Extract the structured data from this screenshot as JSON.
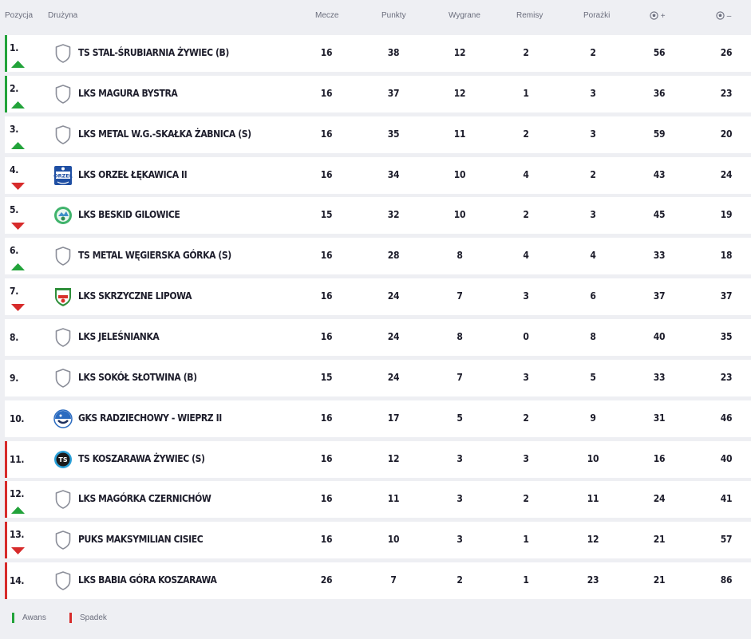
{
  "header": {
    "position": "Pozycja",
    "team": "Drużyna",
    "played": "Mecze",
    "points": "Punkty",
    "won": "Wygrane",
    "drawn": "Remisy",
    "lost": "Porażki",
    "goals_for_sign": "+",
    "goals_against_sign": "–"
  },
  "colors": {
    "promotion": "#22a33a",
    "relegation": "#d72b2b",
    "up_arrow": "#22a33a",
    "down_arrow": "#d72b2b"
  },
  "rows": [
    {
      "pos": "1.",
      "trend": "up",
      "zone": "promo",
      "logo": "shield-placeholder-icon",
      "team": "TS STAL-ŚRUBIARNIA ŻYWIEC (B)",
      "played": "16",
      "points": "38",
      "won": "12",
      "drawn": "2",
      "lost": "2",
      "gf": "56",
      "ga": "26"
    },
    {
      "pos": "2.",
      "trend": "up",
      "zone": "promo",
      "logo": "shield-placeholder-icon",
      "team": "LKS MAGURA BYSTRA",
      "played": "16",
      "points": "37",
      "won": "12",
      "drawn": "1",
      "lost": "3",
      "gf": "36",
      "ga": "23"
    },
    {
      "pos": "3.",
      "trend": "up",
      "zone": "none",
      "logo": "shield-placeholder-icon",
      "team": "LKS METAL W.G.-SKAŁKA ŻABNICA (S)",
      "played": "16",
      "points": "35",
      "won": "11",
      "drawn": "2",
      "lost": "3",
      "gf": "59",
      "ga": "20"
    },
    {
      "pos": "4.",
      "trend": "down",
      "zone": "none",
      "logo": "orzel-crest-icon",
      "team": "LKS ORZEŁ ŁĘKAWICA II",
      "played": "16",
      "points": "34",
      "won": "10",
      "drawn": "4",
      "lost": "2",
      "gf": "43",
      "ga": "24"
    },
    {
      "pos": "5.",
      "trend": "down",
      "zone": "none",
      "logo": "beskid-crest-icon",
      "team": "LKS BESKID GILOWICE",
      "played": "15",
      "points": "32",
      "won": "10",
      "drawn": "2",
      "lost": "3",
      "gf": "45",
      "ga": "19"
    },
    {
      "pos": "6.",
      "trend": "up",
      "zone": "none",
      "logo": "shield-placeholder-icon",
      "team": "TS METAL WĘGIERSKA GÓRKA (S)",
      "played": "16",
      "points": "28",
      "won": "8",
      "drawn": "4",
      "lost": "4",
      "gf": "33",
      "ga": "18"
    },
    {
      "pos": "7.",
      "trend": "down",
      "zone": "none",
      "logo": "skrzyczne-crest-icon",
      "team": "LKS SKRZYCZNE LIPOWA",
      "played": "16",
      "points": "24",
      "won": "7",
      "drawn": "3",
      "lost": "6",
      "gf": "37",
      "ga": "37"
    },
    {
      "pos": "8.",
      "trend": "none",
      "zone": "none",
      "logo": "shield-placeholder-icon",
      "team": "LKS JELEŚNIANKA",
      "played": "16",
      "points": "24",
      "won": "8",
      "drawn": "0",
      "lost": "8",
      "gf": "40",
      "ga": "35"
    },
    {
      "pos": "9.",
      "trend": "none",
      "zone": "none",
      "logo": "shield-placeholder-icon",
      "team": "LKS SOKÓŁ SŁOTWINA (B)",
      "played": "15",
      "points": "24",
      "won": "7",
      "drawn": "3",
      "lost": "5",
      "gf": "33",
      "ga": "23"
    },
    {
      "pos": "10.",
      "trend": "none",
      "zone": "none",
      "logo": "wieprz-crest-icon",
      "team": "GKS RADZIECHOWY - WIEPRZ II",
      "played": "16",
      "points": "17",
      "won": "5",
      "drawn": "2",
      "lost": "9",
      "gf": "31",
      "ga": "46"
    },
    {
      "pos": "11.",
      "trend": "none",
      "zone": "releg",
      "logo": "koszarawa-crest-icon",
      "team": "TS KOSZARAWA ŻYWIEC (S)",
      "played": "16",
      "points": "12",
      "won": "3",
      "drawn": "3",
      "lost": "10",
      "gf": "16",
      "ga": "40"
    },
    {
      "pos": "12.",
      "trend": "up",
      "zone": "releg",
      "logo": "shield-placeholder-icon",
      "team": "LKS MAGÓRKA CZERNICHÓW",
      "played": "16",
      "points": "11",
      "won": "3",
      "drawn": "2",
      "lost": "11",
      "gf": "24",
      "ga": "41"
    },
    {
      "pos": "13.",
      "trend": "down",
      "zone": "releg",
      "logo": "shield-placeholder-icon",
      "team": "PUKS MAKSYMILIAN CISIEC",
      "played": "16",
      "points": "10",
      "won": "3",
      "drawn": "1",
      "lost": "12",
      "gf": "21",
      "ga": "57"
    },
    {
      "pos": "14.",
      "trend": "none",
      "zone": "releg",
      "logo": "shield-placeholder-icon",
      "team": "LKS BABIA GÓRA KOSZARAWA",
      "played": "26",
      "points": "7",
      "won": "2",
      "drawn": "1",
      "lost": "23",
      "gf": "21",
      "ga": "86"
    }
  ],
  "legend": {
    "promotion": "Awans",
    "relegation": "Spadek"
  }
}
